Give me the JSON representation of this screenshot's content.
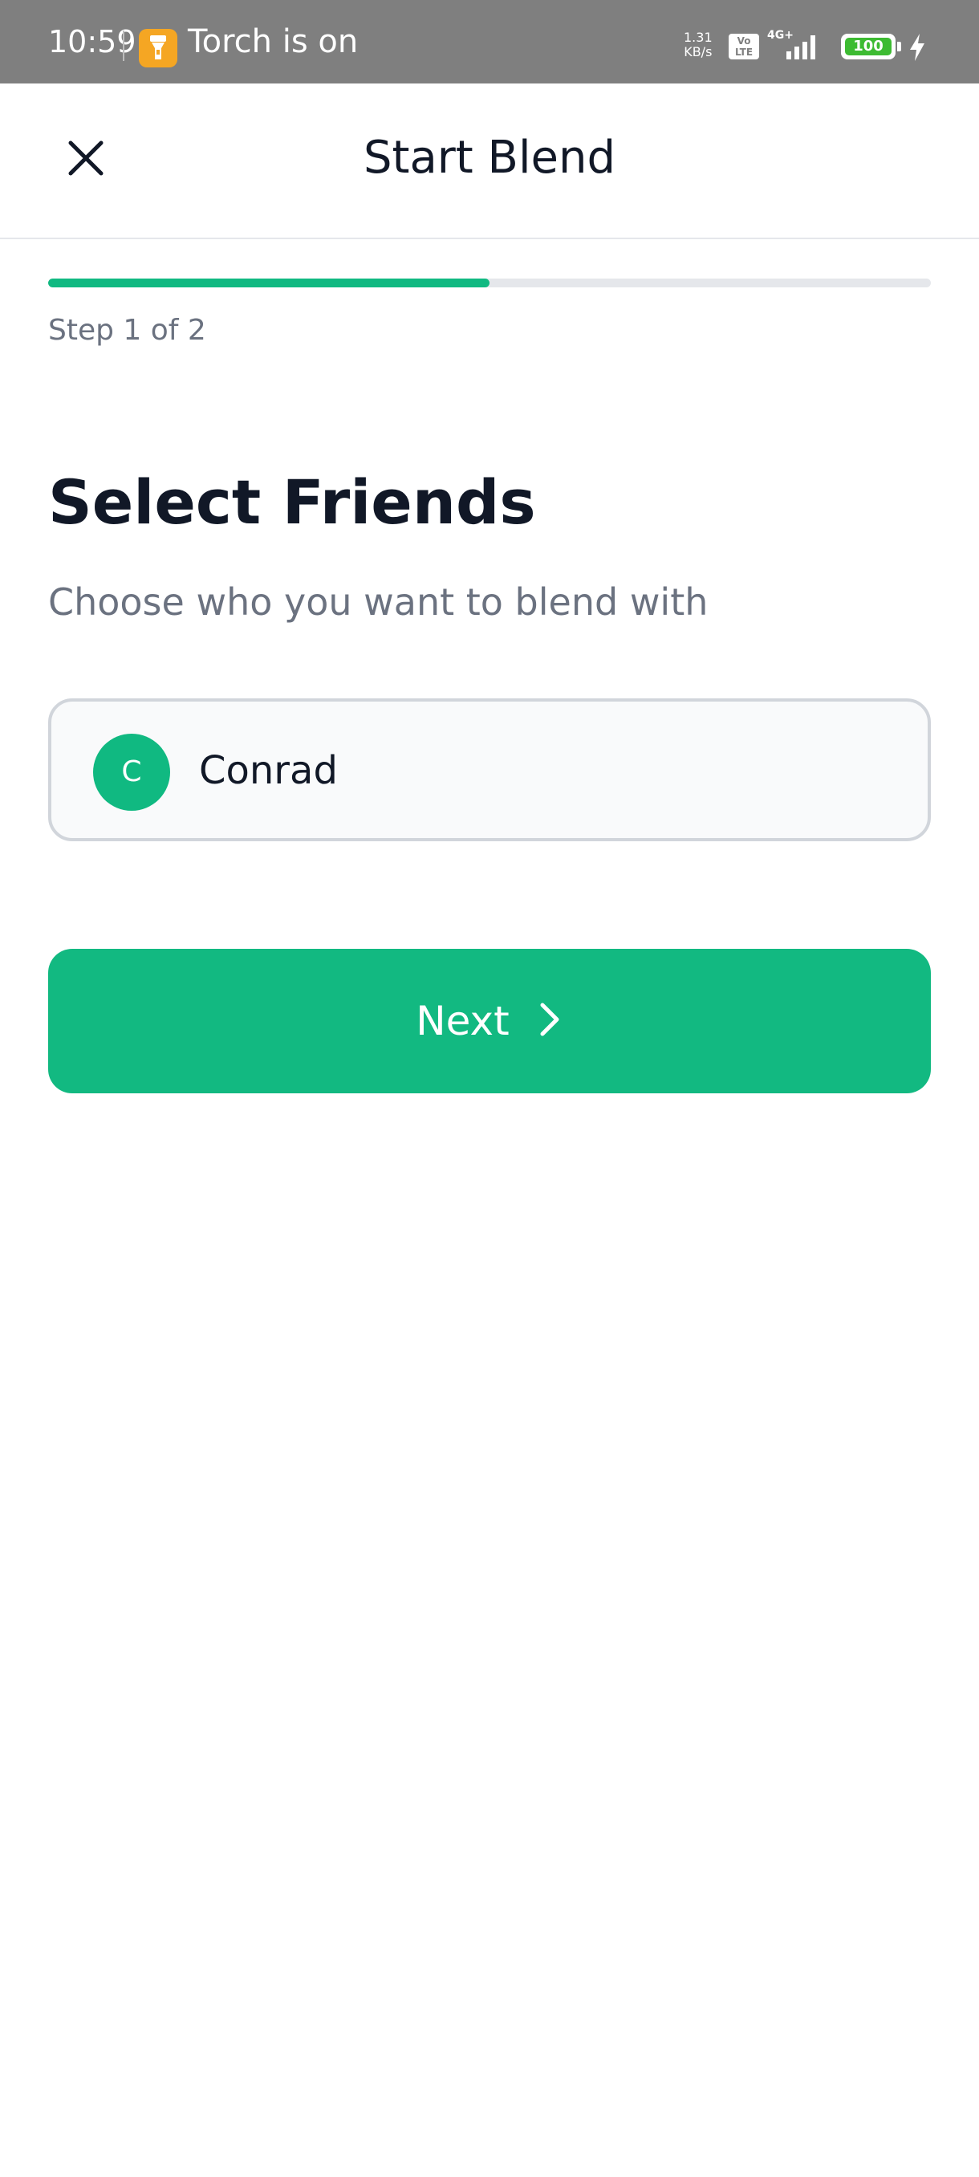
{
  "status_bar": {
    "time": "10:59",
    "torch_text": "Torch is on",
    "speed_value": "1.31",
    "speed_unit": "KB/s",
    "volte": "Vo LTE",
    "network": "4G+",
    "battery": "100",
    "colors": {
      "bar": "#7f7f7f",
      "battery": "#3dbb32",
      "torch_badge": "#f5a623"
    }
  },
  "header": {
    "title": "Start Blend",
    "close_icon": "close-icon"
  },
  "progress": {
    "step_text": "Step 1 of 2",
    "fraction": 0.5,
    "color": "#10b981"
  },
  "section": {
    "title": "Select Friends",
    "subtitle": "Choose who you want to blend with"
  },
  "friends": [
    {
      "initial": "C",
      "name": "Conrad"
    }
  ],
  "next_button": {
    "label": "Next",
    "icon": "chevron-right-icon",
    "color": "#12b981"
  }
}
